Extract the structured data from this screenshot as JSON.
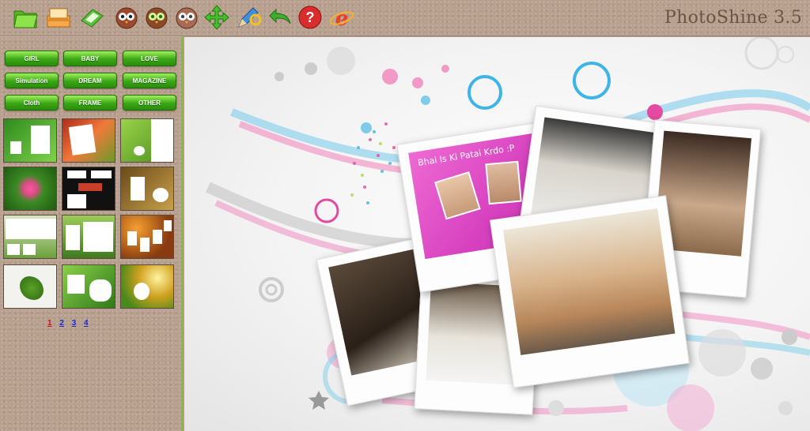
{
  "app": {
    "title": "PhotoShine 3.5"
  },
  "toolbar": {
    "buttons": [
      {
        "name": "open-folder-icon"
      },
      {
        "name": "save-icon"
      },
      {
        "name": "print-icon"
      },
      {
        "name": "owl-icon"
      },
      {
        "name": "owl-green-icon"
      },
      {
        "name": "owl-light-icon"
      },
      {
        "name": "move-arrows-icon"
      },
      {
        "name": "edit-pencil-icon"
      },
      {
        "name": "undo-icon"
      },
      {
        "name": "help-icon"
      },
      {
        "name": "internet-explorer-icon"
      }
    ]
  },
  "categories": [
    {
      "label": "GIRL"
    },
    {
      "label": "BABY"
    },
    {
      "label": "LOVE"
    },
    {
      "label": "Simulation"
    },
    {
      "label": "DREAM"
    },
    {
      "label": "MAGAZINE"
    },
    {
      "label": "Cloth"
    },
    {
      "label": "FRAME"
    },
    {
      "label": "OTHER"
    }
  ],
  "pager": {
    "pages": [
      "1",
      "2",
      "3",
      "4"
    ],
    "current": "1"
  },
  "canvas": {
    "caption": "Bhai Is Ki Patai Krdo :P"
  },
  "colors": {
    "accent_green": "#3aa715",
    "sidebar_border": "#7fbf3f",
    "pink": "#d842c0",
    "title": "#6b5443"
  }
}
